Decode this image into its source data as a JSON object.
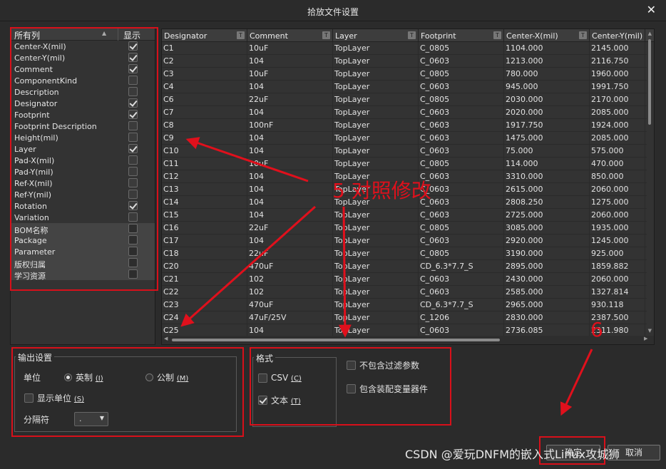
{
  "window": {
    "title": "拾放文件设置",
    "close_glyph": "✕"
  },
  "columns_panel": {
    "header_name": "所有列",
    "header_show": "显示",
    "items": [
      {
        "label": "Center-X(mil)",
        "checked": true
      },
      {
        "label": "Center-Y(mil)",
        "checked": true
      },
      {
        "label": "Comment",
        "checked": true
      },
      {
        "label": "ComponentKind",
        "checked": false
      },
      {
        "label": "Description",
        "checked": false
      },
      {
        "label": "Designator",
        "checked": true
      },
      {
        "label": "Footprint",
        "checked": true
      },
      {
        "label": "Footprint Description",
        "checked": false
      },
      {
        "label": "Height(mil)",
        "checked": false
      },
      {
        "label": "Layer",
        "checked": true
      },
      {
        "label": "Pad-X(mil)",
        "checked": false
      },
      {
        "label": "Pad-Y(mil)",
        "checked": false
      },
      {
        "label": "Ref-X(mil)",
        "checked": false
      },
      {
        "label": "Ref-Y(mil)",
        "checked": false
      },
      {
        "label": "Rotation",
        "checked": true
      },
      {
        "label": "Variation",
        "checked": false
      },
      {
        "label": "BOM名称",
        "checked": false
      },
      {
        "label": "Package",
        "checked": false
      },
      {
        "label": "Parameter",
        "checked": false
      },
      {
        "label": "版权归属",
        "checked": false
      },
      {
        "label": "学习资源",
        "checked": false
      }
    ]
  },
  "grid": {
    "headers": [
      "Designator",
      "Comment",
      "Layer",
      "Footprint",
      "Center-X(mil)",
      "Center-Y(mil)"
    ],
    "rows": [
      [
        "C1",
        "10uF",
        "TopLayer",
        "C_0805",
        "1104.000",
        "2145.000"
      ],
      [
        "C2",
        "104",
        "TopLayer",
        "C_0603",
        "1213.000",
        "2116.750"
      ],
      [
        "C3",
        "10uF",
        "TopLayer",
        "C_0805",
        "780.000",
        "1960.000"
      ],
      [
        "C4",
        "104",
        "TopLayer",
        "C_0603",
        "945.000",
        "1991.750"
      ],
      [
        "C6",
        "22uF",
        "TopLayer",
        "C_0805",
        "2030.000",
        "2170.000"
      ],
      [
        "C7",
        "104",
        "TopLayer",
        "C_0603",
        "2020.000",
        "2085.000"
      ],
      [
        "C8",
        "100nF",
        "TopLayer",
        "C_0603",
        "1917.750",
        "1924.000"
      ],
      [
        "C9",
        "104",
        "TopLayer",
        "C_0603",
        "1475.000",
        "2085.000"
      ],
      [
        "C10",
        "104",
        "TopLayer",
        "C_0603",
        "75.000",
        "575.000"
      ],
      [
        "C11",
        "10uF",
        "TopLayer",
        "C_0805",
        "114.000",
        "470.000"
      ],
      [
        "C12",
        "104",
        "TopLayer",
        "C_0603",
        "3310.000",
        "850.000"
      ],
      [
        "C13",
        "104",
        "TopLayer",
        "C_0603",
        "2615.000",
        "2060.000"
      ],
      [
        "C14",
        "104",
        "TopLayer",
        "C_0603",
        "2808.250",
        "1275.000"
      ],
      [
        "C15",
        "104",
        "TopLayer",
        "C_0603",
        "2725.000",
        "2060.000"
      ],
      [
        "C16",
        "22uF",
        "TopLayer",
        "C_0805",
        "3085.000",
        "1935.000"
      ],
      [
        "C17",
        "104",
        "TopLayer",
        "C_0603",
        "2920.000",
        "1245.000"
      ],
      [
        "C18",
        "22uF",
        "TopLayer",
        "C_0805",
        "3190.000",
        "925.000"
      ],
      [
        "C20",
        "470uF",
        "TopLayer",
        "CD_6.3*7.7_S",
        "2895.000",
        "1859.882"
      ],
      [
        "C21",
        "102",
        "TopLayer",
        "C_0603",
        "2430.000",
        "2060.000"
      ],
      [
        "C22",
        "102",
        "TopLayer",
        "C_0603",
        "2585.000",
        "1327.814"
      ],
      [
        "C23",
        "470uF",
        "TopLayer",
        "CD_6.3*7.7_S",
        "2965.000",
        "930.118"
      ],
      [
        "C24",
        "47uF/25V",
        "TopLayer",
        "C_1206",
        "2830.000",
        "2387.500"
      ],
      [
        "C25",
        "104",
        "TopLayer",
        "C_0603",
        "2736.085",
        "2311.980"
      ]
    ]
  },
  "output_settings": {
    "title": "输出设置",
    "unit_label": "单位",
    "unit_imperial": "英制",
    "unit_imperial_key": "(I)",
    "unit_metric": "公制",
    "unit_metric_key": "(M)",
    "show_units": "显示单位",
    "show_units_key": "(S)",
    "separator_label": "分隔符",
    "separator_value": "."
  },
  "format": {
    "title": "格式",
    "csv": "CSV",
    "csv_key": "(C)",
    "csv_checked": false,
    "text": "文本",
    "text_key": "(T)",
    "text_checked": true,
    "exclude_filter": "不包含过滤参数",
    "include_variants": "包含装配变量器件"
  },
  "buttons": {
    "ok": "确定",
    "cancel": "取消"
  },
  "annotations": {
    "step5": "5 对照修改",
    "step6": "6"
  },
  "watermark": "CSDN @爱玩DNFM的嵌入式Linux攻城狮"
}
